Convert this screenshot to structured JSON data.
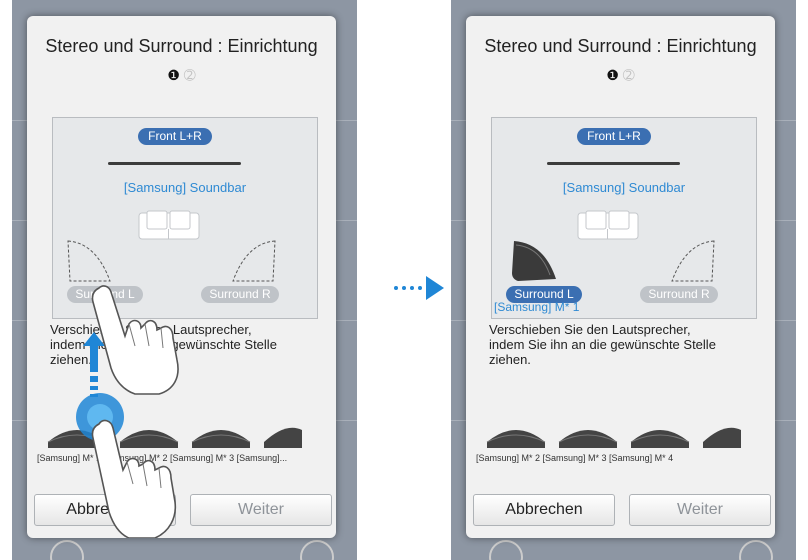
{
  "screens": [
    {
      "title": "Stereo und Surround : Einrichtung",
      "front_label": "Front L+R",
      "soundbar_label": "[Samsung] Soundbar",
      "surround_left": "Surround L",
      "surround_right": "Surround R",
      "placed_speaker_label": "",
      "hint": "Verschieben Sie den Lautsprecher, indem Sie ihn an die gewünschte Stelle ziehen.",
      "speaker_labels": "[Samsung] M* 1 [Samsung] M* 2 [Samsung] M* 3 [Samsung]...",
      "cancel_label": "Abbrechen",
      "next_label": "Weiter"
    },
    {
      "title": "Stereo und Surround : Einrichtung",
      "front_label": "Front L+R",
      "soundbar_label": "[Samsung] Soundbar",
      "surround_left": "Surround L",
      "surround_right": "Surround R",
      "placed_speaker_label": "[Samsung] M* 1",
      "hint": "Verschieben Sie den Lautsprecher, indem Sie ihn an die gewünschte Stelle ziehen.",
      "speaker_labels": "[Samsung] M* 2 [Samsung] M* 3 [Samsung] M* 4",
      "cancel_label": "Abbrechen",
      "next_label": "Weiter"
    }
  ],
  "page_indicator": {
    "page1": "1",
    "page2": "2"
  },
  "colors": {
    "accent_blue": "#3b6fb2",
    "link_blue": "#2f8ad3",
    "inactive_pill": "#bfc3c8",
    "phone_bg": "#8d96a3"
  },
  "icons": [
    "hand-drag-icon",
    "hand-tap-icon",
    "drag-arrow-icon",
    "next-arrow-icon",
    "sofa-icon",
    "speaker-icon"
  ]
}
